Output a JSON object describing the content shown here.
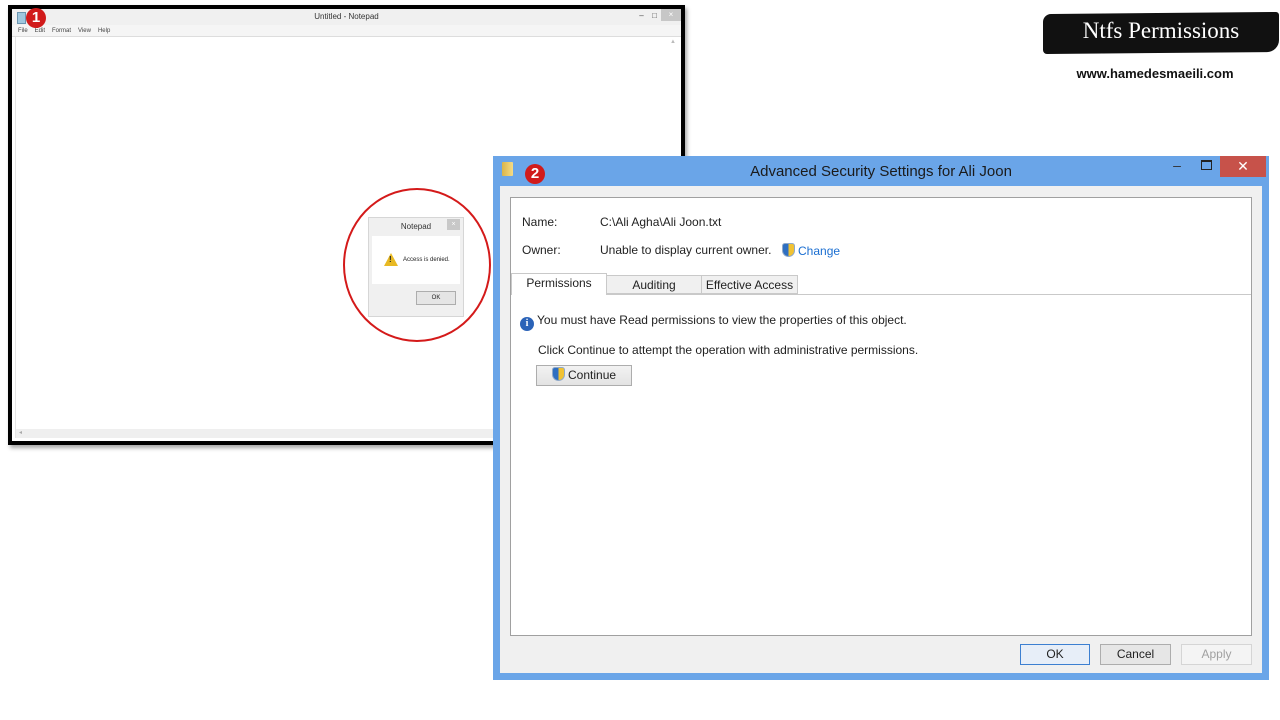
{
  "notepad": {
    "title": "Untitled - Notepad",
    "menu": [
      "File",
      "Edit",
      "Format",
      "View",
      "Help"
    ],
    "controls": {
      "minimize": "–",
      "maximize": "□",
      "close": "×"
    },
    "badge": "1"
  },
  "error_dialog": {
    "title": "Notepad",
    "close": "×",
    "message": "Access is denied.",
    "ok_label": "OK",
    "icon": "warning-icon"
  },
  "brand": {
    "title": "Ntfs Permissions",
    "url": "www.hamedesmaeili.com"
  },
  "advanced_security": {
    "badge": "2",
    "title": "Advanced Security Settings for Ali Joon",
    "controls": {
      "minimize": "–",
      "close": "✕"
    },
    "name_label": "Name:",
    "name_value": "C:\\Ali Agha\\Ali Joon.txt",
    "owner_label": "Owner:",
    "owner_value": "Unable to display current owner.",
    "change_link": "Change",
    "tabs": [
      {
        "label": "Permissions",
        "active": true
      },
      {
        "label": "Auditing",
        "active": false
      },
      {
        "label": "Effective Access",
        "active": false
      }
    ],
    "info_message": "You must have Read permissions to view the properties of this object.",
    "continue_hint": "Click Continue to attempt the operation with administrative permissions.",
    "continue_label": "Continue",
    "buttons": {
      "ok": "OK",
      "cancel": "Cancel",
      "apply": "Apply"
    },
    "colors": {
      "frame": "#6aa5e8",
      "close": "#c7524a",
      "link": "#1a6ed1"
    }
  }
}
